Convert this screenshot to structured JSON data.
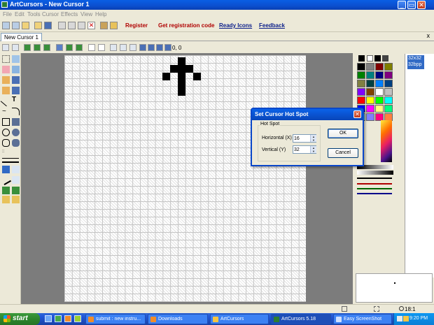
{
  "window": {
    "title": "ArtCursors - New Cursor 1",
    "minimize_icon": "_",
    "maximize_icon": "▭",
    "close_icon": "✕"
  },
  "menu": [
    "File",
    "Edit",
    "Tools",
    "Cursor",
    "Effects",
    "View",
    "Help"
  ],
  "toolbar": {
    "register_label": "Register",
    "get_code_label": "Get registration code",
    "ready_icons_label": "Ready Icons",
    "feedback_label": "Feedback"
  },
  "document_tab": {
    "label": "New Cursor 1",
    "close": "x"
  },
  "coordinates": "0, 0",
  "formats": {
    "selected_size": "32x32",
    "selected_depth": "32bpp"
  },
  "palette_colors": [
    "#000000",
    "#808080",
    "#800000",
    "#808000",
    "#008000",
    "#008080",
    "#000080",
    "#800080",
    "#808040",
    "#004040",
    "#0080ff",
    "#004080",
    "#8000ff",
    "#804000",
    "#ffffff",
    "#c0c0c0",
    "#ff0000",
    "#ffff00",
    "#00ff00",
    "#00ffff",
    "#0000ff",
    "#ff00ff",
    "#ffff80",
    "#00ff80",
    "#80ffff",
    "#8080ff",
    "#ff0080",
    "#ff8040",
    "#c0c0c0",
    "#e0e0e0"
  ],
  "dialog": {
    "title": "Set Cursor Hot Spot",
    "group_label": "Hot Spot",
    "horizontal_label": "Horizontal (X)",
    "horizontal_value": "16",
    "vertical_label": "Vertical (Y)",
    "vertical_value": "32",
    "ok_label": "OK",
    "cancel_label": "Cancel",
    "close_icon": "✕"
  },
  "status": {
    "zoom": "18:1"
  },
  "taskbar": {
    "start_label": "start",
    "tasks": [
      {
        "label": "submit : new instru..."
      },
      {
        "label": "Downloads"
      },
      {
        "label": "ArtCursors"
      },
      {
        "label": "ArtCursors 5.18"
      },
      {
        "label": "Easy ScreenShot"
      }
    ],
    "clock": "9:20 PM"
  }
}
